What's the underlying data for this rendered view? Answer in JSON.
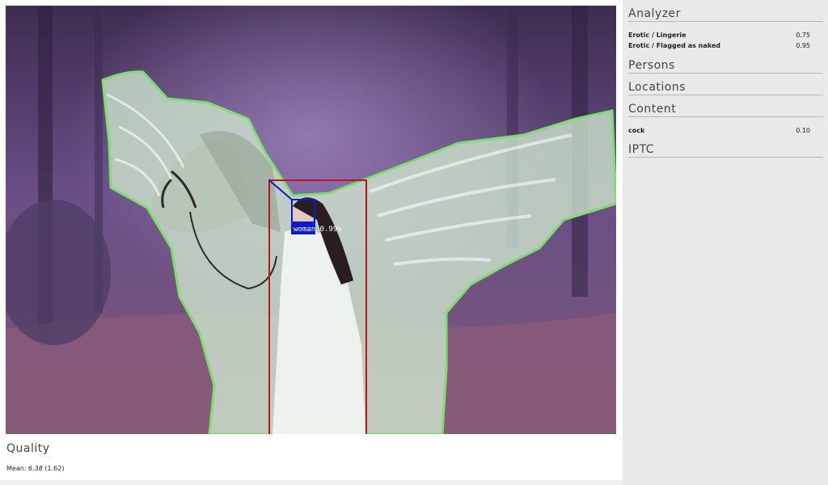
{
  "photo": {
    "detection_label": "woman 0.99%",
    "colors": {
      "forest": "#5a4470",
      "wings_overlay": "#cfe9d0",
      "outline": "#7dde6e",
      "person_box": "#c0141a",
      "face_box": "#0a1ccc"
    }
  },
  "quality": {
    "title": "Quality",
    "mean_prefix": "Mean:",
    "mean_value": "6.38",
    "mean_std": "(1.62)"
  },
  "panel": {
    "analyzer": {
      "title": "Analyzer",
      "rows": [
        {
          "label": "Erotic / Lingerie",
          "value": "0.75"
        },
        {
          "label": "Erotic / Flagged as naked",
          "value": "0.95"
        }
      ]
    },
    "persons": {
      "title": "Persons"
    },
    "locations": {
      "title": "Locations"
    },
    "content": {
      "title": "Content",
      "rows": [
        {
          "label": "cock",
          "value": "0.10"
        }
      ]
    },
    "iptc": {
      "title": "IPTC"
    }
  }
}
